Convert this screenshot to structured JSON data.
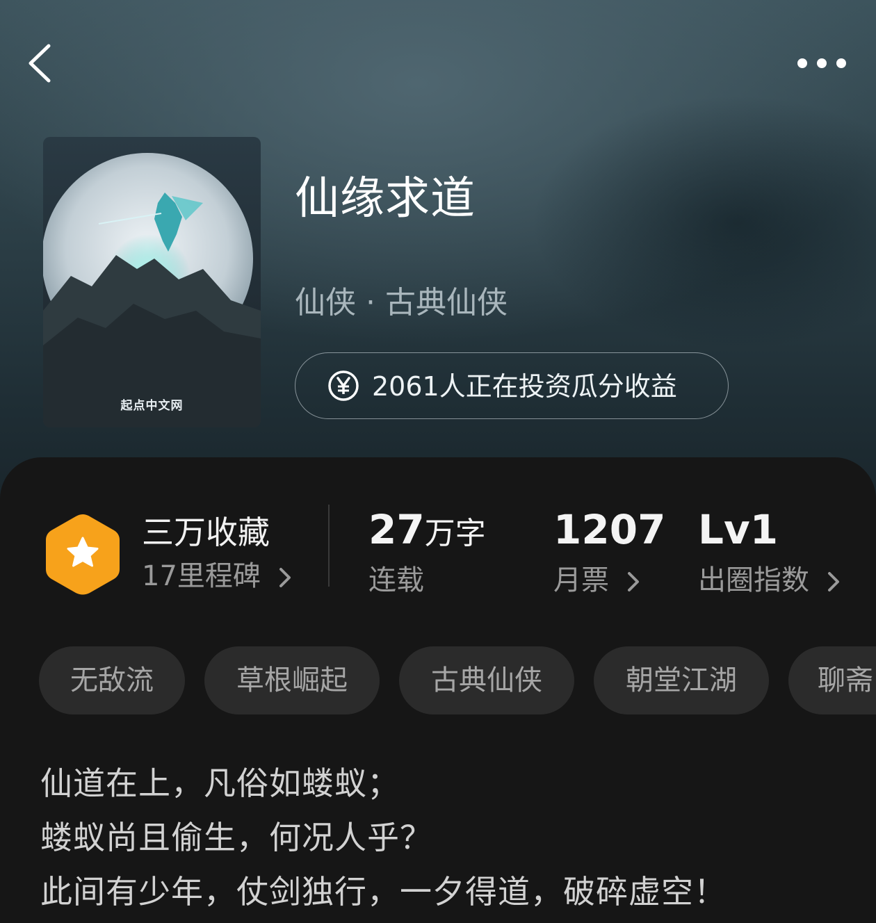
{
  "nav": {
    "back_icon": "chevron-left-icon",
    "more_icon": "more-dots-icon"
  },
  "book": {
    "cover_watermark": "起点中文网",
    "title": "仙缘求道",
    "genre": "仙侠 · 古典仙侠",
    "invest_icon": "yen-circle-icon",
    "invest_text": "2061人正在投资瓜分收益"
  },
  "stats": {
    "badge_icon": "star-hexagon-icon",
    "collect_title": "三万收藏",
    "milestone": "17里程碑",
    "words_number": "27",
    "words_unit": "万字",
    "words_label": "连载",
    "monthly_number": "1207",
    "monthly_label": "月票",
    "level_number": "Lv1",
    "level_label": "出圈指数"
  },
  "tags": [
    "无敌流",
    "草根崛起",
    "古典仙侠",
    "朝堂江湖",
    "聊斋"
  ],
  "description": [
    "仙道在上，凡俗如蝼蚁；",
    "蝼蚁尚且偷生，何况人乎？",
    "此间有少年，仗剑独行，一夕得道，破碎虚空！"
  ],
  "colors": {
    "badge_orange": "#f7a21b",
    "panel_bg": "#161616",
    "tag_bg": "#2b2b2b"
  }
}
